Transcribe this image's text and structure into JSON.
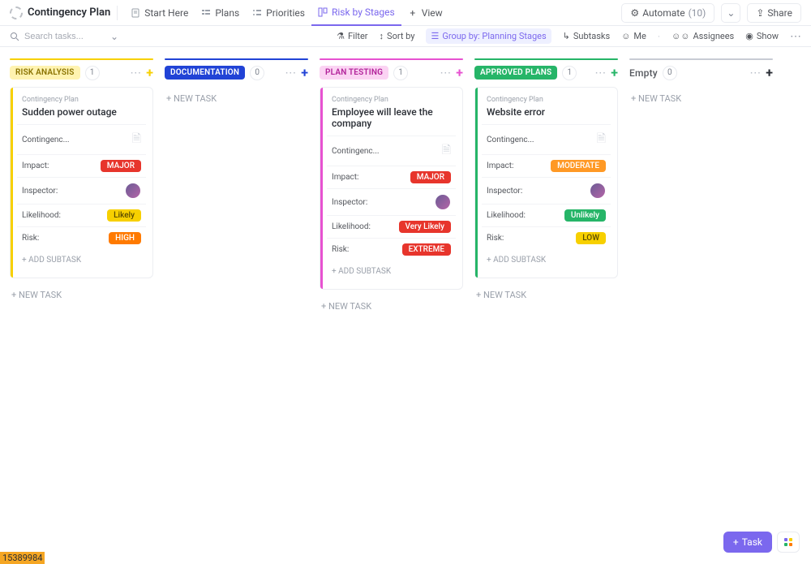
{
  "header": {
    "title": "Contingency Plan",
    "tabs": [
      {
        "label": "Start Here"
      },
      {
        "label": "Plans"
      },
      {
        "label": "Priorities"
      },
      {
        "label": "Risk by Stages"
      },
      {
        "label": "View"
      }
    ],
    "automate_label": "Automate",
    "automate_count": "(10)",
    "share_label": "Share"
  },
  "toolbar": {
    "search_placeholder": "Search tasks...",
    "filter": "Filter",
    "sort": "Sort by",
    "group": "Group by: Planning Stages",
    "subtasks": "Subtasks",
    "me": "Me",
    "assignees": "Assignees",
    "show": "Show"
  },
  "columns": [
    {
      "label": "RISK ANALYSIS",
      "count": "1",
      "stripe": "#f7d000",
      "label_bg": "#fff3b0",
      "label_fg": "#8a7300",
      "plus": "#f7d000",
      "cards": [
        {
          "folder": "Contingency Plan",
          "title": "Sudden power outage",
          "fields": [
            {
              "name": "Contingenc...",
              "type": "doc"
            },
            {
              "name": "Impact:",
              "type": "badge",
              "value": "MAJOR",
              "bg": "#e7352c"
            },
            {
              "name": "Inspector:",
              "type": "avatar"
            },
            {
              "name": "Likelihood:",
              "type": "badge",
              "value": "Likely",
              "bg": "#f7d000",
              "fg": "#5b4b00"
            },
            {
              "name": "Risk:",
              "type": "badge",
              "value": "HIGH",
              "bg": "#ff7a00"
            }
          ]
        }
      ]
    },
    {
      "label": "DOCUMENTATION",
      "count": "0",
      "stripe": "#2143d6",
      "label_bg": "#2143d6",
      "label_fg": "#ffffff",
      "plus": "#2143d6",
      "cards": []
    },
    {
      "label": "PLAN TESTING",
      "count": "1",
      "stripe": "#e752d1",
      "label_bg": "#fbd3f3",
      "label_fg": "#b2229a",
      "plus": "#e752d1",
      "cards": [
        {
          "folder": "Contingency Plan",
          "title": "Employee will leave the company",
          "fields": [
            {
              "name": "Contingenc...",
              "type": "doc"
            },
            {
              "name": "Impact:",
              "type": "badge",
              "value": "MAJOR",
              "bg": "#e7352c"
            },
            {
              "name": "Inspector:",
              "type": "avatar"
            },
            {
              "name": "Likelihood:",
              "type": "badge",
              "value": "Very Likely",
              "bg": "#e7352c"
            },
            {
              "name": "Risk:",
              "type": "badge",
              "value": "EXTREME",
              "bg": "#e7352c"
            }
          ]
        }
      ]
    },
    {
      "label": "APPROVED PLANS",
      "count": "1",
      "stripe": "#26b568",
      "label_bg": "#26b568",
      "label_fg": "#ffffff",
      "plus": "#26b568",
      "cards": [
        {
          "folder": "Contingency Plan",
          "title": "Website error",
          "fields": [
            {
              "name": "Contingenc...",
              "type": "doc"
            },
            {
              "name": "Impact:",
              "type": "badge",
              "value": "MODERATE",
              "bg": "#ff9925"
            },
            {
              "name": "Inspector:",
              "type": "avatar"
            },
            {
              "name": "Likelihood:",
              "type": "badge",
              "value": "Unlikely",
              "bg": "#26b568"
            },
            {
              "name": "Risk:",
              "type": "badge",
              "value": "LOW",
              "bg": "#f7d000",
              "fg": "#5b4b00"
            }
          ]
        }
      ]
    },
    {
      "label": "Empty",
      "count": "0",
      "stripe": "#c8ccd4",
      "label_bg": "transparent",
      "label_fg": "#54575d",
      "plus": "#292d34",
      "plain": true,
      "cards": []
    }
  ],
  "strings": {
    "new_task": "+ NEW TASK",
    "add_subtask": "+ ADD SUBTASK",
    "task_btn": "Task"
  },
  "footer": {
    "id": "15389984"
  }
}
